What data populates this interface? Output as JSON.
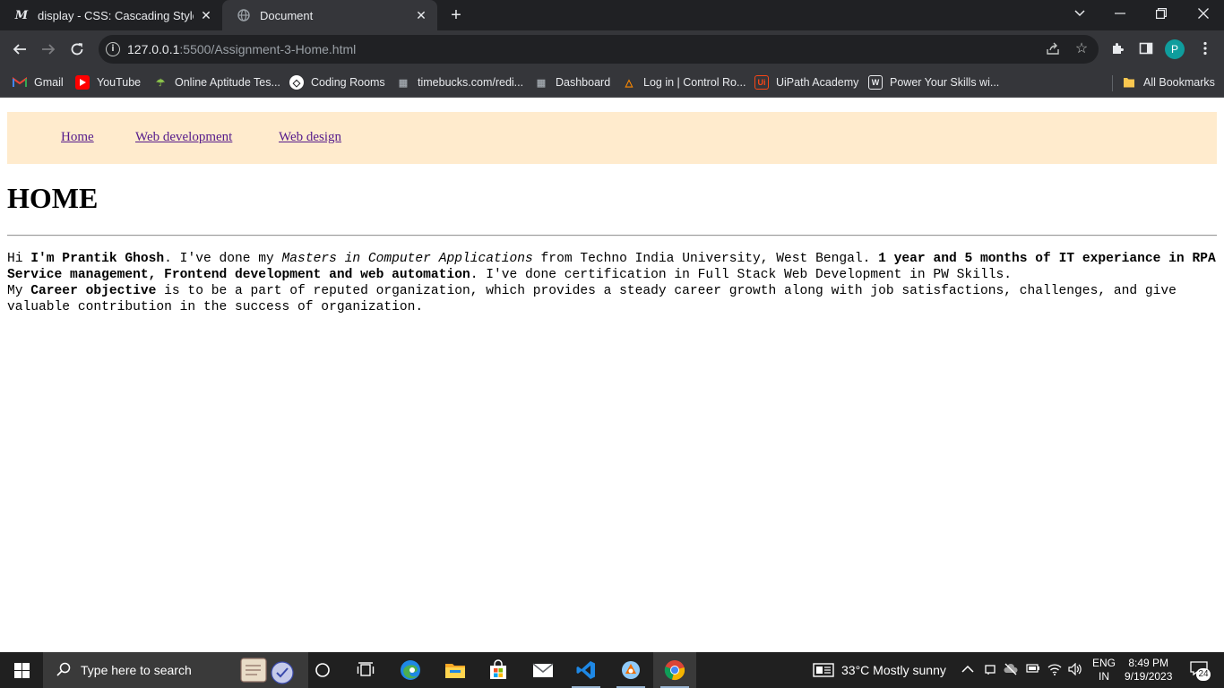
{
  "browser": {
    "tabs": [
      {
        "title": "display - CSS: Cascading Style Sh",
        "favicon": "mdn-icon",
        "active": false
      },
      {
        "title": "Document",
        "favicon": "globe-icon",
        "active": true
      }
    ],
    "address": {
      "host": "127.0.0.1",
      "rest": ":5500/Assignment-3-Home.html"
    },
    "profile_initial": "P",
    "bookmarks": [
      {
        "label": "Gmail",
        "icon": "gmail-icon"
      },
      {
        "label": "YouTube",
        "icon": "youtube-icon"
      },
      {
        "label": "Online Aptitude Tes...",
        "icon": "aptitude-icon"
      },
      {
        "label": "Coding Rooms",
        "icon": "codingrooms-icon"
      },
      {
        "label": "timebucks.com/redi...",
        "icon": "timebucks-icon"
      },
      {
        "label": "Dashboard",
        "icon": "dashboard-icon"
      },
      {
        "label": "Log in | Control Ro...",
        "icon": "controlroom-icon"
      },
      {
        "label": "UiPath Academy",
        "icon": "uipath-icon"
      },
      {
        "label": "Power Your Skills wi...",
        "icon": "pwskills-icon"
      }
    ],
    "all_bookmarks": "All Bookmarks"
  },
  "page": {
    "nav": [
      "Home",
      "Web development",
      "Web design"
    ],
    "heading": "HOME",
    "para1": {
      "t1": "Hi ",
      "b1": "I'm Prantik Ghosh",
      "t2": ". I've done my ",
      "i1": "Masters in Computer Applications",
      "t3": " from Techno India University, West Bengal. ",
      "b2": "1 year and 5 months of IT experiance in RPA Service management, Frontend development and web automation",
      "t4": ". I've done certification in Full Stack Web Development in PW Skills."
    },
    "para2": {
      "t1": "My ",
      "b1": "Career objective",
      "t2": " is to be a part of reputed organization, which provides a steady career growth along with job satisfactions, challenges, and give valuable contribution in the success of organization."
    }
  },
  "taskbar": {
    "search_placeholder": "Type here to search",
    "weather": "33°C  Mostly sunny",
    "lang_top": "ENG",
    "lang_bottom": "IN",
    "time": "8:49 PM",
    "date": "9/19/2023",
    "notifications": "24"
  }
}
